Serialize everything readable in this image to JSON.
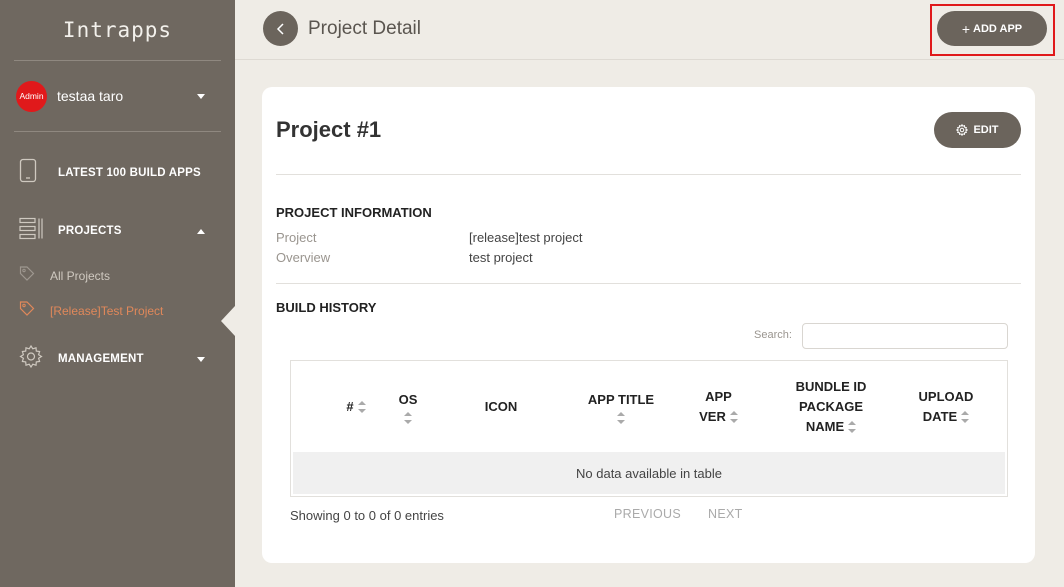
{
  "sidebar": {
    "brand": "Intrapps",
    "user": {
      "badge": "Admin",
      "name": "testaa taro"
    },
    "items": [
      {
        "label": "LATEST 100 BUILD APPS"
      },
      {
        "label": "PROJECTS"
      },
      {
        "label": "MANAGEMENT"
      }
    ],
    "sub_items": [
      {
        "label": "All Projects"
      },
      {
        "label": "[Release]Test Project"
      }
    ]
  },
  "header": {
    "title": "Project Detail",
    "add_app_label": "ADD APP",
    "add_app_plus": "+"
  },
  "project": {
    "title": "Project #1",
    "edit_label": "EDIT",
    "info_heading": "PROJECT INFORMATION",
    "fields": [
      {
        "label": "Project",
        "value": "[release]test project"
      },
      {
        "label": "Overview",
        "value": "test project"
      }
    ]
  },
  "build_history": {
    "heading": "BUILD HISTORY",
    "search_label": "Search:",
    "search_value": "",
    "columns": [
      {
        "line1": "#",
        "line2": "",
        "line3": ""
      },
      {
        "line1": "OS",
        "line2": "",
        "line3": ""
      },
      {
        "line1": "ICON",
        "line2": "",
        "line3": ""
      },
      {
        "line1": "APP TITLE",
        "line2": "",
        "line3": ""
      },
      {
        "line1": "APP",
        "line2": "VER",
        "line3": ""
      },
      {
        "line1": "BUNDLE ID",
        "line2": "PACKAGE",
        "line3": "NAME"
      },
      {
        "line1": "UPLOAD",
        "line2": "DATE",
        "line3": ""
      }
    ],
    "empty_message": "No data available in table",
    "showing": "Showing 0 to 0 of 0 entries",
    "previous_label": "PREVIOUS",
    "next_label": "NEXT"
  },
  "colors": {
    "sidebar_bg": "#6f6860",
    "button_bg": "#6b645c",
    "avatar_red": "#e0191b",
    "active_orange": "#e0885a",
    "highlight_red": "#e0191b"
  }
}
